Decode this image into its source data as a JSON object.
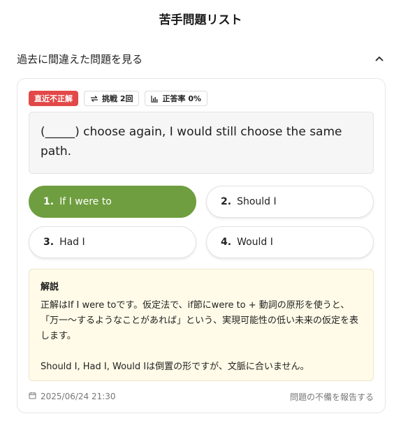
{
  "header": {
    "title": "苦手問題リスト"
  },
  "section": {
    "title": "過去に間違えた問題を見る",
    "icon": "chevron-up-icon"
  },
  "card": {
    "badges": {
      "status": "直近不正解",
      "attempts": "挑戦 2回",
      "accuracy": "正答率 0%",
      "status_color": "#e34848"
    },
    "question": "(_____) choose again, I would still choose the same path.",
    "choices": [
      {
        "num": "1.",
        "label": "If I were to",
        "selected": true
      },
      {
        "num": "2.",
        "label": "Should I",
        "selected": false
      },
      {
        "num": "3.",
        "label": "Had I",
        "selected": false
      },
      {
        "num": "4.",
        "label": "Would I",
        "selected": false
      }
    ],
    "selected_color": "#6e9e3f",
    "explanation": {
      "title": "解説",
      "paragraph1": "正解はIf I were toです。仮定法で、if節にwere to + 動詞の原形を使うと、「万一〜するようなことがあれば」という、実現可能性の低い未来の仮定を表します。",
      "paragraph2": "Should I, Had I, Would Iは倒置の形ですが、文脈に合いません。"
    },
    "footer": {
      "date": "2025/06/24 21:30",
      "report": "問題の不備を報告する"
    }
  }
}
